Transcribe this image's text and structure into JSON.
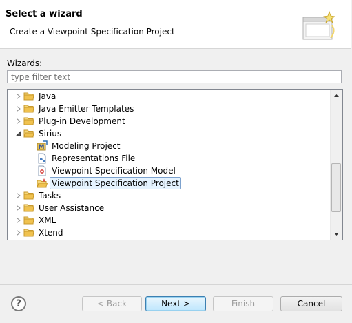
{
  "header": {
    "title": "Select a wizard",
    "subtitle": "Create a Viewpoint Specification Project",
    "icon": "wizard-banner-icon"
  },
  "wizards_label": "Wizards:",
  "filter": {
    "placeholder": "type filter text",
    "value": ""
  },
  "tree": {
    "items": [
      {
        "label": "Java",
        "icon": "folder-icon",
        "expanded": false
      },
      {
        "label": "Java Emitter Templates",
        "icon": "folder-icon",
        "expanded": false
      },
      {
        "label": "Plug-in Development",
        "icon": "folder-icon",
        "expanded": false
      },
      {
        "label": "Sirius",
        "icon": "folder-icon",
        "expanded": true
      },
      {
        "label": "Modeling Project",
        "icon": "modeling-project-icon"
      },
      {
        "label": "Representations File",
        "icon": "representations-file-icon"
      },
      {
        "label": "Viewpoint Specification Model",
        "icon": "viewpoint-model-icon"
      },
      {
        "label": "Viewpoint Specification Project",
        "icon": "viewpoint-project-icon",
        "selected": true
      },
      {
        "label": "Tasks",
        "icon": "folder-icon",
        "expanded": false
      },
      {
        "label": "User Assistance",
        "icon": "folder-icon",
        "expanded": false
      },
      {
        "label": "XML",
        "icon": "folder-icon",
        "expanded": false
      },
      {
        "label": "Xtend",
        "icon": "folder-icon",
        "expanded": false
      }
    ]
  },
  "buttons": {
    "help": "?",
    "back": "< Back",
    "next": "Next >",
    "finish": "Finish",
    "cancel": "Cancel"
  },
  "colors": {
    "selection_bg": "#e5f3ff",
    "selection_border": "#7da2ce",
    "folder": "#e8b84a"
  }
}
